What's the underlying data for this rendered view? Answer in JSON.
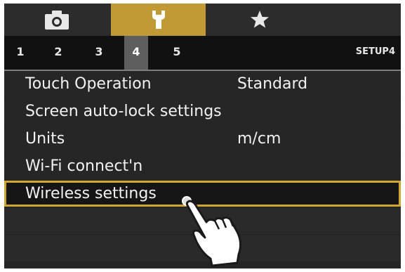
{
  "tabs": [
    {
      "icon": "camera-icon",
      "active": false
    },
    {
      "icon": "wrench-icon",
      "active": true
    },
    {
      "icon": "star-icon",
      "active": false
    }
  ],
  "pages": [
    "1",
    "2",
    "3",
    "4",
    "5"
  ],
  "active_page": "4",
  "menu_tab_label": "SETUP4",
  "menu": [
    {
      "label": "Touch Operation",
      "value": "Standard"
    },
    {
      "label": "Screen auto-lock settings",
      "value": ""
    },
    {
      "label": "Units",
      "value": "m/cm"
    },
    {
      "label": "Wi-Fi connect'n",
      "value": ""
    },
    {
      "label": "Wireless settings",
      "value": "",
      "selected": true
    }
  ],
  "colors": {
    "accent": "#c09a35",
    "background": "#252525"
  }
}
